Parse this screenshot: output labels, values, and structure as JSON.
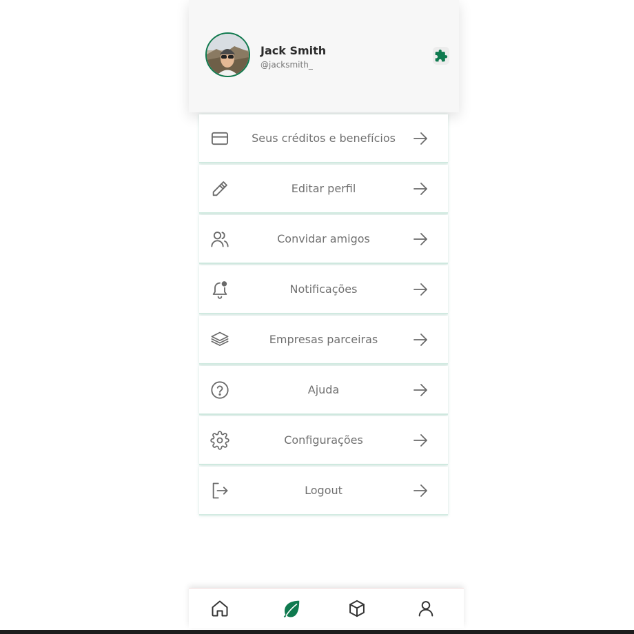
{
  "profile": {
    "name": "Jack Smith",
    "handle": "@jacksmith_",
    "accent_color": "#0f7a4f",
    "action_icon": "puzzle-icon"
  },
  "menu": {
    "items": [
      {
        "label": "Seus créditos e benefícios",
        "icon": "credit-card-icon"
      },
      {
        "label": "Editar perfil",
        "icon": "pencil-icon"
      },
      {
        "label": "Convidar amigos",
        "icon": "users-icon"
      },
      {
        "label": "Notificações",
        "icon": "bell-icon"
      },
      {
        "label": "Empresas parceiras",
        "icon": "layers-icon"
      },
      {
        "label": "Ajuda",
        "icon": "help-circle-icon"
      },
      {
        "label": "Configurações",
        "icon": "gear-icon"
      },
      {
        "label": "Logout",
        "icon": "logout-icon"
      }
    ],
    "arrow_icon": "arrow-right-icon"
  },
  "bottom_nav": {
    "items": [
      {
        "icon": "home-icon"
      },
      {
        "icon": "leaf-icon",
        "active": true
      },
      {
        "icon": "box-icon"
      },
      {
        "icon": "user-icon"
      }
    ],
    "active_color": "#0f7a4f"
  }
}
